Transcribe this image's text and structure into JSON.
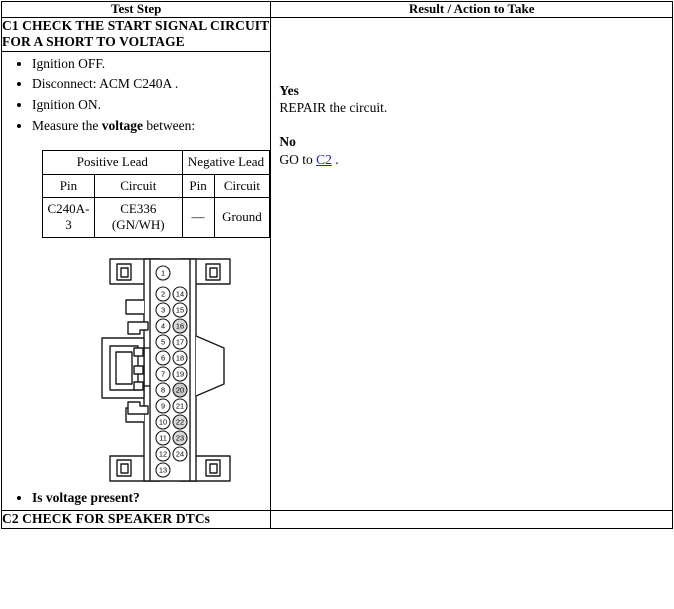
{
  "table": {
    "headers": {
      "test_step": "Test Step",
      "result_action": "Result / Action to Take"
    }
  },
  "step_c1": {
    "title": "C1 CHECK THE START SIGNAL CIRCUIT FOR A SHORT TO VOLTAGE",
    "bullets": [
      {
        "text": "Ignition OFF."
      },
      {
        "text": "Disconnect: ACM C240A ."
      },
      {
        "text": "Ignition ON."
      },
      {
        "pre": "Measure the ",
        "bold": "voltage",
        "post": " between:"
      }
    ],
    "question": "Is voltage present?",
    "result": {
      "yes_label": "Yes",
      "yes_text": "REPAIR the circuit.",
      "no_label": "No",
      "no_prefix": "GO to ",
      "no_link": "C2",
      "no_suffix": " ."
    }
  },
  "pin_table": {
    "group_positive": "Positive Lead",
    "group_negative": "Negative Lead",
    "col_pin_1": "Pin",
    "col_circuit_1": "Circuit",
    "col_pin_2": "Pin",
    "col_circuit_2": "Circuit",
    "row": {
      "pin_1": "C240A-3",
      "circuit_1_name": "CE336",
      "circuit_1_color": "(GN/WH)",
      "pin_2": "—",
      "circuit_2": "Ground"
    }
  },
  "connector": {
    "name": "C240A",
    "pin_labels_left": [
      "1",
      "2",
      "3",
      "4",
      "5",
      "6",
      "7",
      "8",
      "9",
      "10",
      "11",
      "12",
      "13"
    ],
    "pin_labels_right": [
      "14",
      "15",
      "16",
      "17",
      "18",
      "19",
      "20",
      "21",
      "22",
      "23",
      "24"
    ],
    "filled_pins": [
      "16",
      "20",
      "22",
      "23"
    ]
  },
  "step_c2": {
    "title": "C2 CHECK FOR SPEAKER DTCs"
  },
  "colors": {
    "border": "#000000",
    "link": "#2222cc",
    "text": "#000000",
    "background": "#ffffff",
    "connector_fill": "#ffffff",
    "connector_shade": "#d8d8d8"
  }
}
